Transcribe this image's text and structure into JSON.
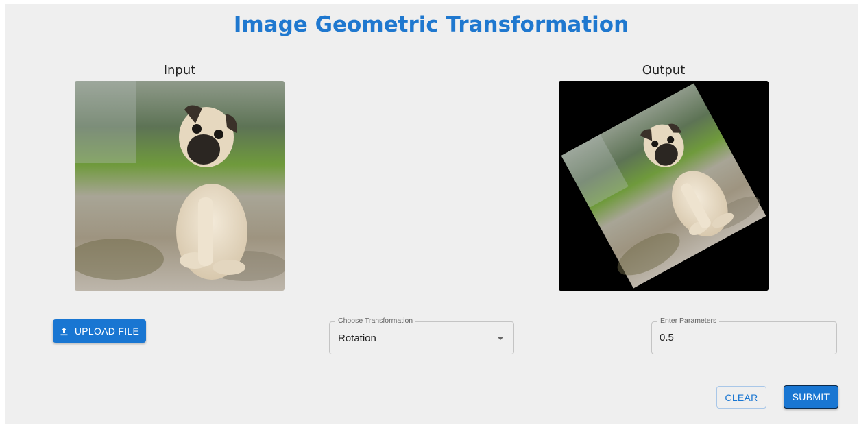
{
  "app": {
    "title": "Image Geometric Transformation"
  },
  "input_panel": {
    "label": "Input"
  },
  "output_panel": {
    "label": "Output"
  },
  "upload": {
    "label": "UPLOAD FILE",
    "icon": "upload-icon"
  },
  "transformation": {
    "legend": "Choose Transformation",
    "selected": "Rotation",
    "icon": "chevron-down-icon"
  },
  "parameters": {
    "legend": "Enter Parameters",
    "value": "0.5"
  },
  "actions": {
    "clear_label": "CLEAR",
    "submit_label": "SUBMIT"
  },
  "colors": {
    "primary": "#1976d2",
    "title": "#1f78cf",
    "background": "#efefef"
  }
}
